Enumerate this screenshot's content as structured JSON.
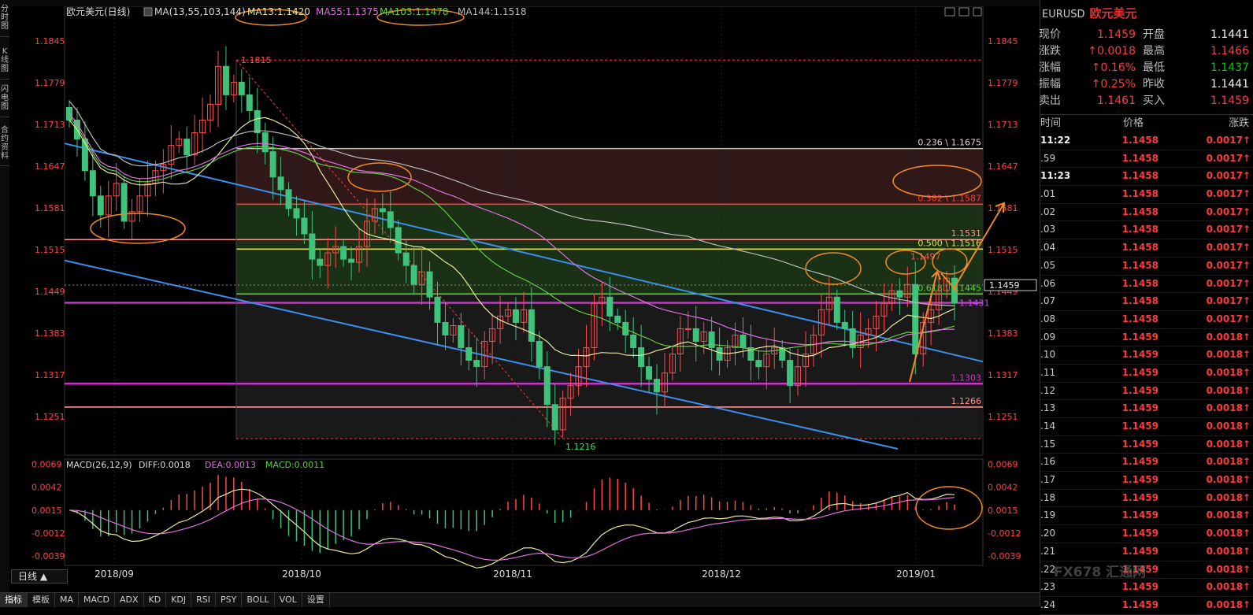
{
  "header": {
    "symbol_cn": "欧元美元(日线)",
    "ma_params": "MA(13,55,103,144)",
    "ma13": "MA13:1.1420",
    "ma55": "MA55:1.1375",
    "ma103": "MA103:1.1478",
    "ma144": "MA144:1.1518"
  },
  "left_tabs": [
    "分时图",
    "K线图",
    "闪电图",
    "合约资料"
  ],
  "period_button": "日线 ▲",
  "bottom_tabs": [
    "指标",
    "模板",
    "MA",
    "MACD",
    "ADX",
    "KD",
    "KDJ",
    "RSI",
    "PSY",
    "BOLL",
    "VOL",
    "设置"
  ],
  "macd_header": {
    "params": "MACD(26,12,9)",
    "diff": "DIFF:0.0018",
    "dea": "DEA:0.0013",
    "macd": "MACD:0.0011"
  },
  "colors": {
    "ma13": "#e8e89a",
    "ma55": "#5fcf3f",
    "ma103": "#e070e0",
    "ma144": "#bbbbbb",
    "up": "#ff4a4a",
    "down": "#3fc27a",
    "trend": "#3a8ff0",
    "fib_top": "#c0c0c0",
    "fib_red": "#ff3b3b",
    "fib_pink": "#ff9090",
    "fib_yellow": "#e0e04a",
    "fib_magenta": "#cc33cc",
    "orange": "#f08a24"
  },
  "chart_data": {
    "type": "candlestick",
    "price_axis_ticks": [
      1.1845,
      1.1779,
      1.1713,
      1.1647,
      1.1581,
      1.1515,
      1.1449,
      1.1383,
      1.1317,
      1.1251
    ],
    "ylim": [
      1.119,
      1.19
    ],
    "x_axis_labels": [
      "2018/09",
      "2018/10",
      "2018/11",
      "2018/12",
      "2019/01"
    ],
    "close_series": [
      1.172,
      1.169,
      1.164,
      1.16,
      1.157,
      1.16,
      1.162,
      1.156,
      1.1575,
      1.16,
      1.162,
      1.164,
      1.165,
      1.168,
      1.169,
      1.1665,
      1.17,
      1.172,
      1.1745,
      1.1805,
      1.176,
      1.178,
      1.176,
      1.1735,
      1.17,
      1.167,
      1.163,
      1.161,
      1.158,
      1.1565,
      1.154,
      1.15,
      1.149,
      1.151,
      1.152,
      1.15,
      1.1495,
      1.152,
      1.156,
      1.158,
      1.1575,
      1.155,
      1.151,
      1.149,
      1.146,
      1.148,
      1.144,
      1.14,
      1.138,
      1.1395,
      1.136,
      1.134,
      1.133,
      1.137,
      1.139,
      1.141,
      1.142,
      1.14,
      1.142,
      1.137,
      1.133,
      1.127,
      1.123,
      1.128,
      1.13,
      1.133,
      1.136,
      1.143,
      1.144,
      1.141,
      1.14,
      1.138,
      1.136,
      1.133,
      1.131,
      1.129,
      1.132,
      1.135,
      1.139,
      1.139,
      1.137,
      1.1385,
      1.136,
      1.134,
      1.136,
      1.138,
      1.136,
      1.134,
      1.133,
      1.135,
      1.136,
      1.134,
      1.13,
      1.133,
      1.135,
      1.138,
      1.142,
      1.144,
      1.14,
      1.139,
      1.136,
      1.138,
      1.139,
      1.141,
      1.143,
      1.145,
      1.144,
      1.146,
      1.135,
      1.14,
      1.142,
      1.145,
      1.147,
      1.1431
    ],
    "price_high": 1.1815,
    "price_low": 1.1216,
    "annotations": [
      "1.1815",
      "1.1216",
      "1.1497",
      "1.1431",
      "1.1459"
    ],
    "fib_levels": [
      {
        "label": "0.236 \\ 1.1675",
        "value": 1.1675,
        "kind": "top"
      },
      {
        "label": "0.382 \\ 1.1587",
        "value": 1.1587,
        "kind": "red"
      },
      {
        "label": "1.1531",
        "value": 1.1531,
        "kind": "pink"
      },
      {
        "label": "0.500 \\ 1.1516",
        "value": 1.1516,
        "kind": "yellow"
      },
      {
        "label": "0.618 \\ 1.1445",
        "value": 1.1445,
        "kind": "green"
      },
      {
        "label": "",
        "value": 1.1431,
        "kind": "magenta"
      },
      {
        "label": "1.1303",
        "value": 1.1303,
        "kind": "magenta"
      },
      {
        "label": "1.1266",
        "value": 1.1266,
        "kind": "pink"
      }
    ],
    "current_price_label": "1.1459",
    "macd": {
      "axis_ticks": [
        "0.0069",
        "0.0042",
        "0.0015",
        "-0.0012",
        "-0.0039"
      ],
      "ylim": [
        -0.005,
        0.0075
      ]
    }
  },
  "quote": {
    "title_symbol": "EURUSD",
    "title_name": "欧元美元",
    "rows": [
      {
        "l1": "现价",
        "v1": "1.1459",
        "c1": "red",
        "l2": "开盘",
        "v2": "1.1441",
        "c2": "white"
      },
      {
        "l1": "涨跌",
        "v1": "↑0.0018",
        "c1": "red",
        "l2": "最高",
        "v2": "1.1466",
        "c2": "red"
      },
      {
        "l1": "涨幅",
        "v1": "↑0.16%",
        "c1": "red",
        "l2": "最低",
        "v2": "1.1437",
        "c2": "green"
      },
      {
        "l1": "振幅",
        "v1": "↑0.25%",
        "c1": "red",
        "l2": "昨收",
        "v2": "1.1441",
        "c2": "white"
      },
      {
        "l1": "卖出",
        "v1": "1.1461",
        "c1": "red",
        "l2": "买入",
        "v2": "1.1459",
        "c2": "red"
      }
    ],
    "tick_headers": [
      "时间",
      "价格",
      "涨跌"
    ],
    "ticks": [
      {
        "t": "11:22",
        "p": "1.1458",
        "c": "0.0017↑"
      },
      {
        "t": ".59",
        "p": "1.1458",
        "c": "0.0017↑"
      },
      {
        "t": "11:23",
        "p": "1.1458",
        "c": "0.0017↑"
      },
      {
        "t": ".01",
        "p": "1.1458",
        "c": "0.0017↑"
      },
      {
        "t": ".02",
        "p": "1.1458",
        "c": "0.0017↑"
      },
      {
        "t": ".03",
        "p": "1.1458",
        "c": "0.0017↑"
      },
      {
        "t": ".04",
        "p": "1.1458",
        "c": "0.0017↑"
      },
      {
        "t": ".05",
        "p": "1.1458",
        "c": "0.0017↑"
      },
      {
        "t": ".06",
        "p": "1.1458",
        "c": "0.0017↑"
      },
      {
        "t": ".07",
        "p": "1.1458",
        "c": "0.0017↑"
      },
      {
        "t": ".08",
        "p": "1.1458",
        "c": "0.0017↑"
      },
      {
        "t": ".09",
        "p": "1.1459",
        "c": "0.0018↑"
      },
      {
        "t": ".10",
        "p": "1.1459",
        "c": "0.0018↑"
      },
      {
        "t": ".11",
        "p": "1.1459",
        "c": "0.0018↑"
      },
      {
        "t": ".12",
        "p": "1.1459",
        "c": "0.0018↑"
      },
      {
        "t": ".13",
        "p": "1.1459",
        "c": "0.0018↑"
      },
      {
        "t": ".14",
        "p": "1.1459",
        "c": "0.0018↑"
      },
      {
        "t": ".15",
        "p": "1.1459",
        "c": "0.0018↑"
      },
      {
        "t": ".16",
        "p": "1.1459",
        "c": "0.0018↑"
      },
      {
        "t": ".17",
        "p": "1.1459",
        "c": "0.0018↑"
      },
      {
        "t": ".18",
        "p": "1.1459",
        "c": "0.0018↑"
      },
      {
        "t": ".19",
        "p": "1.1459",
        "c": "0.0018↑"
      },
      {
        "t": ".20",
        "p": "1.1459",
        "c": "0.0018↑"
      },
      {
        "t": ".21",
        "p": "1.1459",
        "c": "0.0018↑"
      },
      {
        "t": ".22",
        "p": "1.1459",
        "c": "0.0018↑"
      },
      {
        "t": ".23",
        "p": "1.1459",
        "c": "0.0018↑"
      },
      {
        "t": ".24",
        "p": "1.1459",
        "c": "0.0018↑"
      }
    ]
  },
  "watermark": "FX678 汇通网"
}
